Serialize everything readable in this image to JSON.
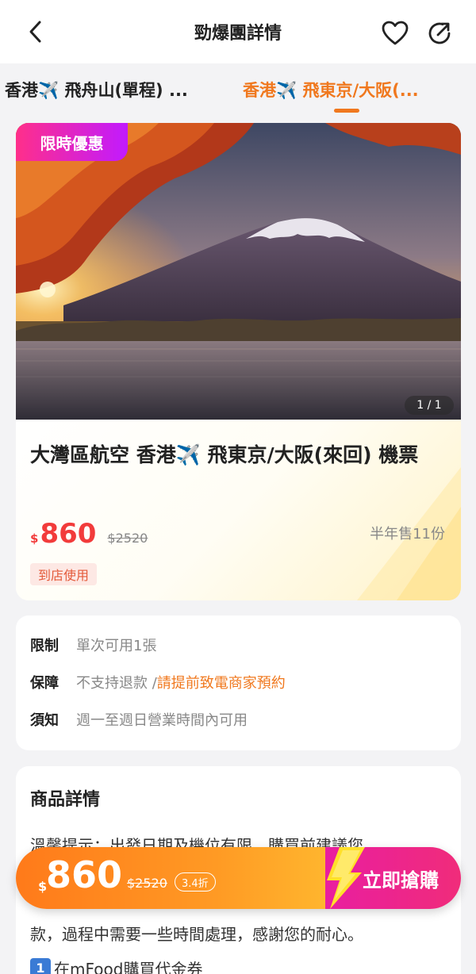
{
  "header": {
    "title": "勁爆團詳情"
  },
  "tabs": [
    {
      "label": "香港✈️ 飛舟山(單程) ...",
      "active": false
    },
    {
      "label": "香港✈️ 飛東京/大阪(...",
      "active": true
    }
  ],
  "product": {
    "promo_badge": "限時優惠",
    "image_counter": "1 / 1",
    "title": "大灣區航空 香港✈️ 飛東京/大阪(來回) 機票",
    "currency": "$",
    "price": "860",
    "original_price": "$2520",
    "sold": "半年售11份",
    "usage_tag": "到店使用"
  },
  "rules": {
    "limit_key": "限制",
    "limit_value": "單次可用1張",
    "guarantee_key": "保障",
    "guarantee_value": "不支持退款 / ",
    "guarantee_highlight": "請提前致電商家預約",
    "notice_key": "須知",
    "notice_value": "週一至週日營業時間內可用"
  },
  "details": {
    "title": "商品詳情",
    "line1": "溫馨提示：出發日期及機位有限，購買前建議您",
    "line3": "款，過程中需要一些時間處理，感謝您的耐心。",
    "step_badge": "1",
    "step_text": "在mFood購買代金券"
  },
  "buy_bar": {
    "currency": "$",
    "price": "860",
    "original_price": "$2520",
    "discount": "3.4折",
    "buy_label": "立即搶購"
  },
  "colors": {
    "accent": "#f0781e",
    "price_red": "#f23b3b",
    "promo_pink": "#ff2f8a",
    "promo_purple": "#c11aff",
    "buy_pink": "#e91ea0"
  }
}
